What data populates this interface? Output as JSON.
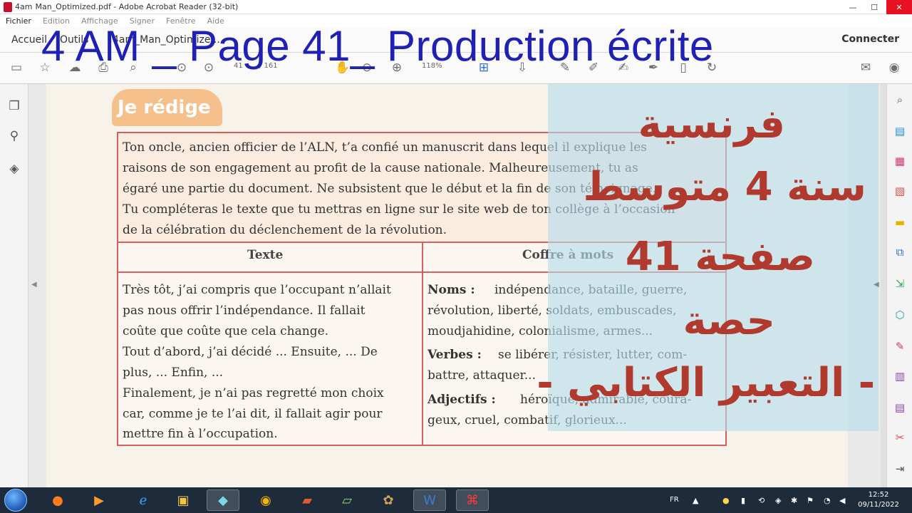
{
  "window": {
    "title": "4am Man_Optimized.pdf - Adobe Acrobat Reader (32-bit)",
    "title_short": "4am",
    "title_rest": "Man_Optimized.pdf - Adobe Acrobat Reader (32-bit)"
  },
  "menu": [
    "Fichier",
    "Edition",
    "Affichage",
    "Signer",
    "Fenêtre",
    "Aide"
  ],
  "nav": {
    "home": "Accueil",
    "tools": "Outils",
    "doc_tab": "4am_Man_Optimize...",
    "connect": "Connecter"
  },
  "toolbar": {
    "page_current": "41",
    "page_total": "/ 161",
    "zoom": "118%"
  },
  "video_title": "4 AM _ Page 41_ Production écrite",
  "overlay": {
    "line1": "فرنسية",
    "line2": "سنة 4 متوسط",
    "line3": "صفحة 41",
    "line4": "حصة",
    "line5": "- التعبير الكتابي -"
  },
  "document": {
    "heading": "Je rédige",
    "prompt": [
      "Ton oncle, ancien officier de l’ALN, t’a confié un manuscrit dans lequel il explique les",
      "raisons de son engagement au profit de la cause nationale. Malheureusement, tu as",
      "égaré une partie du document. Ne subsistent que le début et la fin de son témoignage.",
      "Tu compléteras le texte que tu mettras en ligne sur le site web de ton collège à l’occasion",
      "de la célébration du déclenchement de la révolution."
    ],
    "col_texte": "Texte",
    "col_coffre": "Coffre à mots",
    "texte_lines": [
      "Très tôt, j’ai compris que l’occupant n’allait",
      "pas nous offrir l’indépendance. Il fallait",
      "coûte que coûte que cela change.",
      "Tout d’abord, j’ai décidé ... Ensuite, ... De",
      "plus, ... Enfin, ...",
      "Finalement, je n’ai pas regretté mon choix",
      "car, comme je te l’ai dit, il fallait agir pour",
      "mettre fin à l’occupation."
    ],
    "noms_label": "Noms :",
    "noms_lines": [
      "indépendance, bataille, guerre,",
      "révolution,  liberté, soldats, embuscades,",
      "moudjahidine,  colonialisme,  armes..."
    ],
    "verbes_label": "Verbes :",
    "verbes_lines": [
      "se libérer, résister, lutter, com-",
      "battre,  attaquer..."
    ],
    "adjectifs_label": "Adjectifs :",
    "adjectifs_lines": [
      "héroïque, admirable, coura-",
      "geux,  cruel,  combatif, glorieux..."
    ]
  },
  "taskbar": {
    "lang": "FR",
    "time": "12:52",
    "date": "09/11/2022"
  },
  "colors": {
    "title_blue": "#2020b5",
    "arabic_red": "#b03a2e",
    "table_border": "#d65f5f",
    "heading_orange": "#f5c08b"
  }
}
